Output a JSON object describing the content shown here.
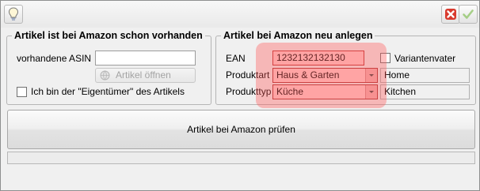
{
  "colors": {
    "highlight": "#ff5a5a",
    "close_red": "#d83a2e",
    "ok_green": "#86c15a"
  },
  "toolbar": {
    "left_icon": "lightbulb-icon",
    "close_icon": "close-icon",
    "ok_icon": "checkmark-icon"
  },
  "existing": {
    "legend": "Artikel ist bei Amazon schon vorhanden",
    "asin_label": "vorhandene ASIN",
    "asin_value": "",
    "open_button_label": "Artikel öffnen",
    "owner_checkbox_label": "Ich bin der \"Eigentümer\" des Artikels",
    "owner_checked": false
  },
  "create": {
    "legend": "Artikel bei Amazon neu anlegen",
    "ean_label": "EAN",
    "ean_value": "1232132132130",
    "variant_label": "Variantenvater",
    "variant_checked": false,
    "produktart_label": "Produktart",
    "produktart_value": "Haus & Garten",
    "produktart_mapped": "Home",
    "produkttyp_label": "Produkttyp",
    "produkttyp_value": "Küche",
    "produkttyp_mapped": "Kitchen"
  },
  "check_button_label": "Artikel bei Amazon prüfen"
}
